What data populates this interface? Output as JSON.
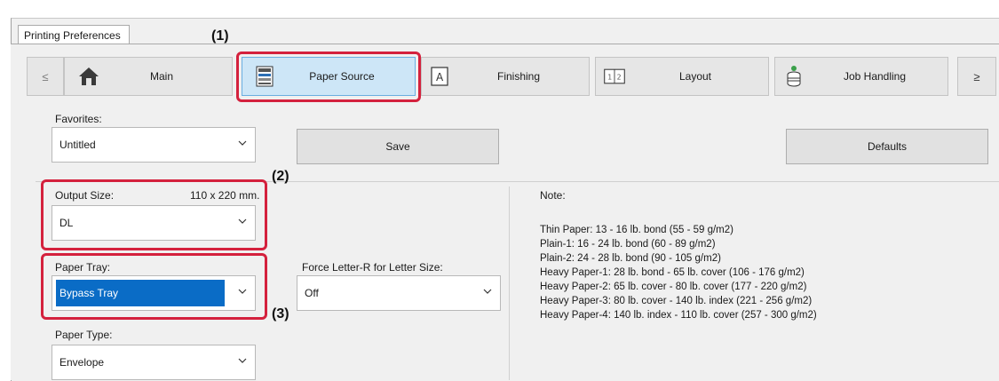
{
  "window": {
    "tab_label": "Printing Preferences"
  },
  "nav": {
    "prev": "≤",
    "next": "≥",
    "items": [
      {
        "label": "Main",
        "icon": "home-icon"
      },
      {
        "label": "Paper Source",
        "icon": "printer-tray-icon"
      },
      {
        "label": "Finishing",
        "icon": "letter-a-page-icon"
      },
      {
        "label": "Layout",
        "icon": "two-page-layout-icon"
      },
      {
        "label": "Job Handling",
        "icon": "job-stack-icon"
      }
    ],
    "active": "Paper Source"
  },
  "favorites": {
    "label": "Favorites:",
    "value": "Untitled",
    "save": "Save",
    "defaults": "Defaults"
  },
  "output_size": {
    "label": "Output Size:",
    "dimensions": "110 x 220 mm.",
    "value": "DL"
  },
  "paper_tray": {
    "label": "Paper Tray:",
    "value": "Bypass Tray"
  },
  "force_letter": {
    "label": "Force Letter-R for Letter Size:",
    "value": "Off"
  },
  "paper_type": {
    "label": "Paper Type:",
    "value": "Envelope"
  },
  "note": {
    "title": "Note:",
    "lines": [
      "Thin Paper: 13 - 16 lb. bond (55 - 59 g/m2)",
      "Plain-1: 16 - 24 lb. bond (60 - 89 g/m2)",
      "Plain-2: 24 - 28 lb. bond (90 - 105 g/m2)",
      "Heavy Paper-1: 28 lb. bond - 65 lb. cover (106 - 176 g/m2)",
      "Heavy Paper-2: 65 lb. cover - 80 lb. cover (177 - 220 g/m2)",
      "Heavy Paper-3: 80 lb. cover - 140 lb. index (221 - 256 g/m2)",
      "Heavy Paper-4: 140 lb. index - 110 lb. cover (257 - 300 g/m2)"
    ]
  },
  "callouts": {
    "c1": "(1)",
    "c2": "(2)",
    "c3": "(3)"
  },
  "colors": {
    "callout": "#d4213d",
    "selection": "#0a6cc6",
    "active_tab": "#cde6f7"
  }
}
